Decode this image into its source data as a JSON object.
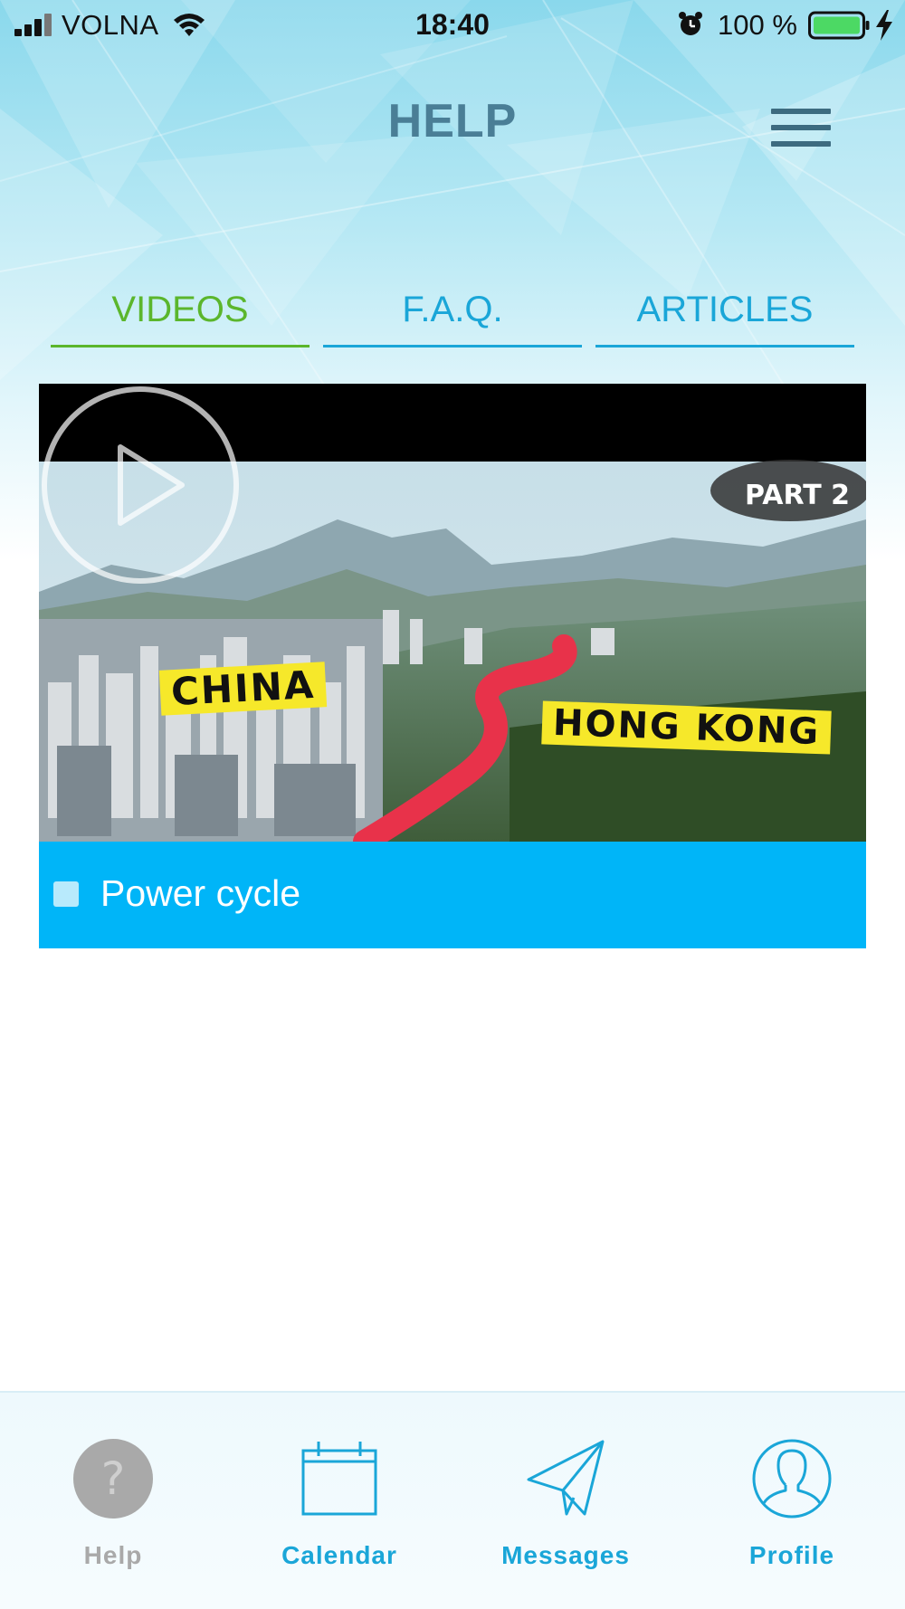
{
  "status_bar": {
    "carrier": "VOLNA",
    "time": "18:40",
    "battery_percent": "100 %",
    "battery_level": 1.0,
    "signal_bars": 4,
    "charging": true
  },
  "header": {
    "title": "HELP",
    "menu_icon": "hamburger-menu-icon"
  },
  "tabs": [
    {
      "label": "VIDEOS",
      "active": true
    },
    {
      "label": "F.A.Q.",
      "active": false
    },
    {
      "label": "ARTICLES",
      "active": false
    }
  ],
  "video": {
    "thumbnail_text": {
      "left_tag": "CHINA",
      "right_tag": "HONG KONG",
      "corner_label": "PART 2"
    },
    "play_icon": "play-icon",
    "caption": "Power cycle"
  },
  "bottom_nav": {
    "items": [
      {
        "label": "Help",
        "icon": "question-icon",
        "active": true
      },
      {
        "label": "Calendar",
        "icon": "calendar-icon",
        "active": false
      },
      {
        "label": "Messages",
        "icon": "paper-plane-icon",
        "active": false
      },
      {
        "label": "Profile",
        "icon": "user-icon",
        "active": false
      }
    ]
  },
  "colors": {
    "accent_blue": "#1aa6d8",
    "active_green": "#5bb62c",
    "caption_bar": "#00b5f8",
    "title_color": "#4a7e96",
    "inactive_gray": "#a9a9a9"
  }
}
